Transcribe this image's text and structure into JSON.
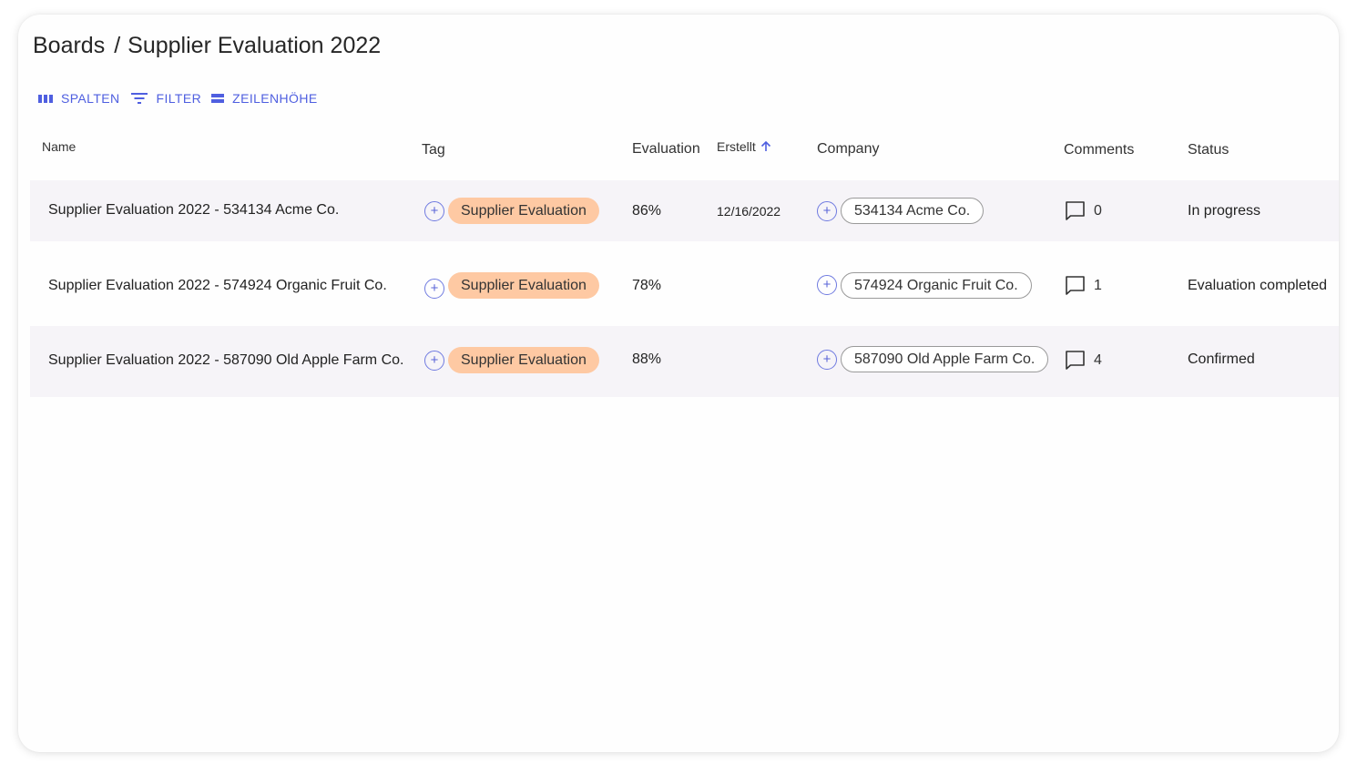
{
  "breadcrumb": {
    "root": "Boards",
    "separator": "/",
    "current": "Supplier Evaluation 2022"
  },
  "toolbar": {
    "columns_label": "SPALTEN",
    "filter_label": "FILTER",
    "density_label": "ZEILENHÖHE"
  },
  "columns": {
    "name": "Name",
    "tag": "Tag",
    "evaluation": "Evaluation",
    "created": "Erstellt",
    "company": "Company",
    "comments": "Comments",
    "status": "Status"
  },
  "sort": {
    "column": "created",
    "direction": "ascending",
    "icon": "arrow-up-icon"
  },
  "rows": [
    {
      "name": "Supplier Evaluation 2022 - 534134 Acme Co.",
      "tag": "Supplier Evaluation",
      "evaluation": "86%",
      "created": "12/16/2022",
      "company": "534134 Acme Co.",
      "comments": "0",
      "status": "In progress"
    },
    {
      "name": "Supplier Evaluation 2022 - 574924 Organic Fruit Co.",
      "tag": "Supplier Evaluation",
      "evaluation": "78%",
      "created": "",
      "company": "574924 Organic Fruit Co.",
      "comments": "1",
      "status": "Evaluation completed"
    },
    {
      "name": "Supplier Evaluation 2022 - 587090 Old Apple Farm Co.",
      "tag": "Supplier Evaluation",
      "evaluation": "88%",
      "created": "",
      "company": "587090 Old Apple Farm Co.",
      "comments": "4",
      "status": "Confirmed"
    }
  ],
  "colors": {
    "accent": "#4f5fe0",
    "tag_bg": "#fec9a3",
    "row_shade": "#f6f4f8"
  },
  "icons": {
    "columns": "columns-icon",
    "filter": "filter-icon",
    "density": "row-height-icon",
    "add": "plus-circle-icon",
    "comment": "comment-icon"
  }
}
